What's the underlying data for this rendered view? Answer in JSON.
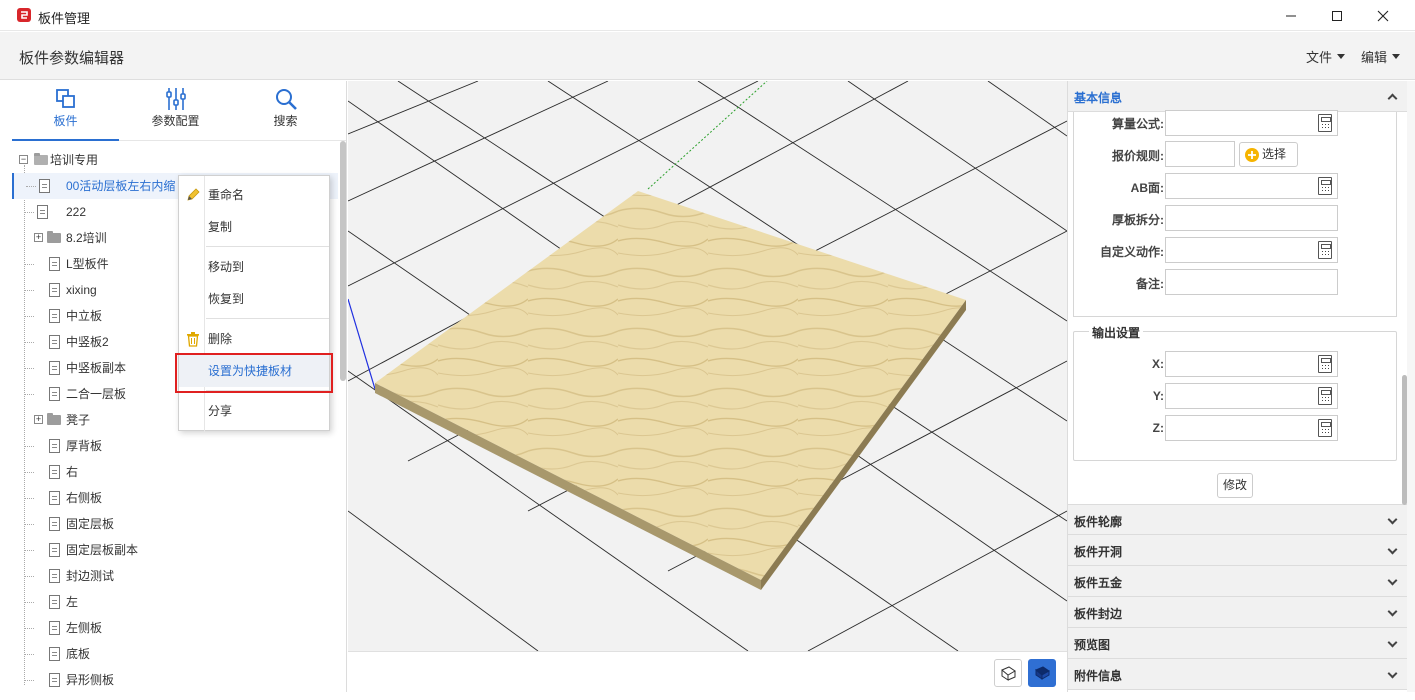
{
  "window": {
    "title": "板件管理",
    "minimize": "—",
    "maximize": "☐",
    "close": "✕"
  },
  "header": {
    "title": "板件参数编辑器",
    "menu_file": "文件",
    "menu_edit": "编辑"
  },
  "tabs": [
    {
      "label": "板件",
      "icon": "layers-icon",
      "active": true
    },
    {
      "label": "参数配置",
      "icon": "sliders-icon"
    },
    {
      "label": "搜索",
      "icon": "search-icon"
    }
  ],
  "tree": {
    "root": "培训专用",
    "items": [
      {
        "label": "00活动层板左右内缩",
        "type": "doc",
        "selected": true
      },
      {
        "label": "222",
        "type": "doc"
      },
      {
        "label": "8.2培训",
        "type": "folder"
      },
      {
        "label": "L型板件",
        "type": "doc"
      },
      {
        "label": "xixing",
        "type": "doc"
      },
      {
        "label": "中立板",
        "type": "doc"
      },
      {
        "label": "中竖板2",
        "type": "doc"
      },
      {
        "label": "中竖板副本",
        "type": "doc"
      },
      {
        "label": "二合一层板",
        "type": "doc"
      },
      {
        "label": "凳子",
        "type": "folder"
      },
      {
        "label": "厚背板",
        "type": "doc"
      },
      {
        "label": "右",
        "type": "doc"
      },
      {
        "label": "右侧板",
        "type": "doc"
      },
      {
        "label": "固定层板",
        "type": "doc"
      },
      {
        "label": "固定层板副本",
        "type": "doc"
      },
      {
        "label": "封边测试",
        "type": "doc"
      },
      {
        "label": "左",
        "type": "doc"
      },
      {
        "label": "左侧板",
        "type": "doc"
      },
      {
        "label": "底板",
        "type": "doc"
      },
      {
        "label": "异形侧板",
        "type": "doc"
      }
    ]
  },
  "context_menu": {
    "rename": "重命名",
    "copy": "复制",
    "move_to": "移动到",
    "restore_to": "恢复到",
    "delete": "删除",
    "set_quick": "设置为快捷板材",
    "share": "分享"
  },
  "right": {
    "basic_info": "基本信息",
    "fields": {
      "formula": "算量公式:",
      "quote_rule": "报价规则:",
      "select_btn": "选择",
      "ab_face": "AB面:",
      "thick_split": "厚板拆分:",
      "custom_action": "自定义动作:",
      "remark": "备注:"
    },
    "output": {
      "legend": "输出设置",
      "x": "X:",
      "y": "Y:",
      "z": "Z:"
    },
    "modify_btn": "修改",
    "sections": [
      "板件轮廓",
      "板件开洞",
      "板件五金",
      "板件封边",
      "预览图",
      "附件信息"
    ]
  },
  "colors": {
    "accent": "#2a6fd1",
    "highlight_border": "#e02020",
    "wood": "#ecdcab"
  }
}
